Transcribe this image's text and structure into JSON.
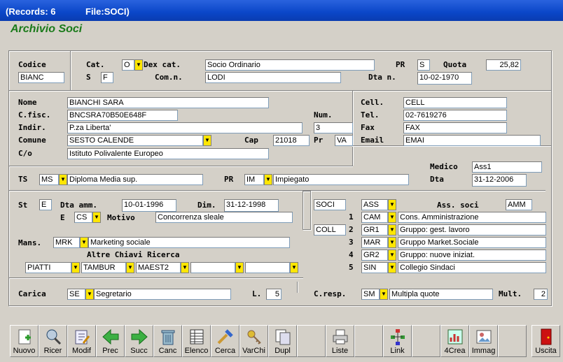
{
  "window": {
    "records": "(Records: 6",
    "file": "File:SOCI)"
  },
  "app_title": "Archivio Soci",
  "labels": {
    "codice": "Codice",
    "cat": "Cat.",
    "dex_cat": "Dex cat.",
    "pr": "PR",
    "quota": "Quota",
    "s": "S",
    "com_n": "Com.n.",
    "dta_n": "Dta n.",
    "nome": "Nome",
    "cfisc": "C.fisc.",
    "num": "Num.",
    "indir": "Indir.",
    "comune": "Comune",
    "cap": "Cap",
    "pr2": "Pr",
    "co": "C/o",
    "cell": "Cell.",
    "tel": "Tel.",
    "fax": "Fax",
    "email": "Email",
    "medico": "Medico",
    "dta": "Dta",
    "ts": "TS",
    "pr3": "PR",
    "st": "St",
    "dta_amm": "Dta amm.",
    "dim": "Dim.",
    "e": "E",
    "motivo": "Motivo",
    "ass_soci": "Ass. soci",
    "mans": "Mans.",
    "altre": "Altre Chiavi Ricerca",
    "carica": "Carica",
    "l": "L.",
    "cresp": "C.resp.",
    "mult": "Mult."
  },
  "fields": {
    "codice": "BIANC",
    "cat": "O",
    "dex_cat": "Socio Ordinario",
    "pr": "S",
    "quota": "25,82",
    "s": "F",
    "com_n": "LODI",
    "dta_n": "10-02-1970",
    "nome": "BIANCHI SARA",
    "cfisc": "BNCSRA70B50E648F",
    "indir": "P.za Liberta'",
    "num": "3",
    "comune": "SESTO CALENDE",
    "cap": "21018",
    "pr2": "VA",
    "co": "Istituto Polivalente Europeo",
    "cell": "CELL",
    "tel": "02-7619276",
    "fax": "FAX",
    "email": "EMAI",
    "medico": "Ass1",
    "dta": "31-12-2006",
    "ts_code": "MS",
    "ts_desc": "Diploma Media sup.",
    "pr3_code": "IM",
    "pr3_desc": "Impiegato",
    "st": "E",
    "dta_amm": "10-01-1996",
    "dim": "31-12-1998",
    "e_code": "CS",
    "motivo": "Concorrenza sleale",
    "soci": "SOCI",
    "coll": "COLL",
    "ass_code": "ASS",
    "ass_soci": "AMM",
    "mans_code": "MRK",
    "mans_desc": "Marketing sociale",
    "key1": "PIATTI",
    "key2": "TAMBUR",
    "key3": "MAEST2",
    "key4": "",
    "key5": "",
    "carica_code": "SE",
    "carica_desc": "Segretario",
    "l": "5",
    "cresp_code": "SM",
    "cresp_desc": "Multipla quote",
    "mult": "2"
  },
  "groups": [
    {
      "n": "1",
      "code": "CAM",
      "desc": "Cons. Amministrazione"
    },
    {
      "n": "2",
      "code": "GR1",
      "desc": "Gruppo: gest. lavoro"
    },
    {
      "n": "3",
      "code": "MAR",
      "desc": "Gruppo Market.Sociale"
    },
    {
      "n": "4",
      "code": "GR2",
      "desc": "Gruppo: nuove iniziat."
    },
    {
      "n": "5",
      "code": "SIN",
      "desc": "Collegio Sindaci"
    }
  ],
  "toolbar": [
    "Nuovo",
    "Ricer",
    "Modif",
    "Prec",
    "Succ",
    "Canc",
    "Elenco",
    "Cerca",
    "VarChi",
    "Dupl",
    "",
    "Liste",
    "",
    "Link",
    "",
    "4Crea",
    "Immag",
    "",
    "Uscita"
  ],
  "colors": {
    "title_green": "#1a7a1a",
    "dropdown_yellow": "#ffe600",
    "titlebar_blue": "#0a46c8"
  }
}
